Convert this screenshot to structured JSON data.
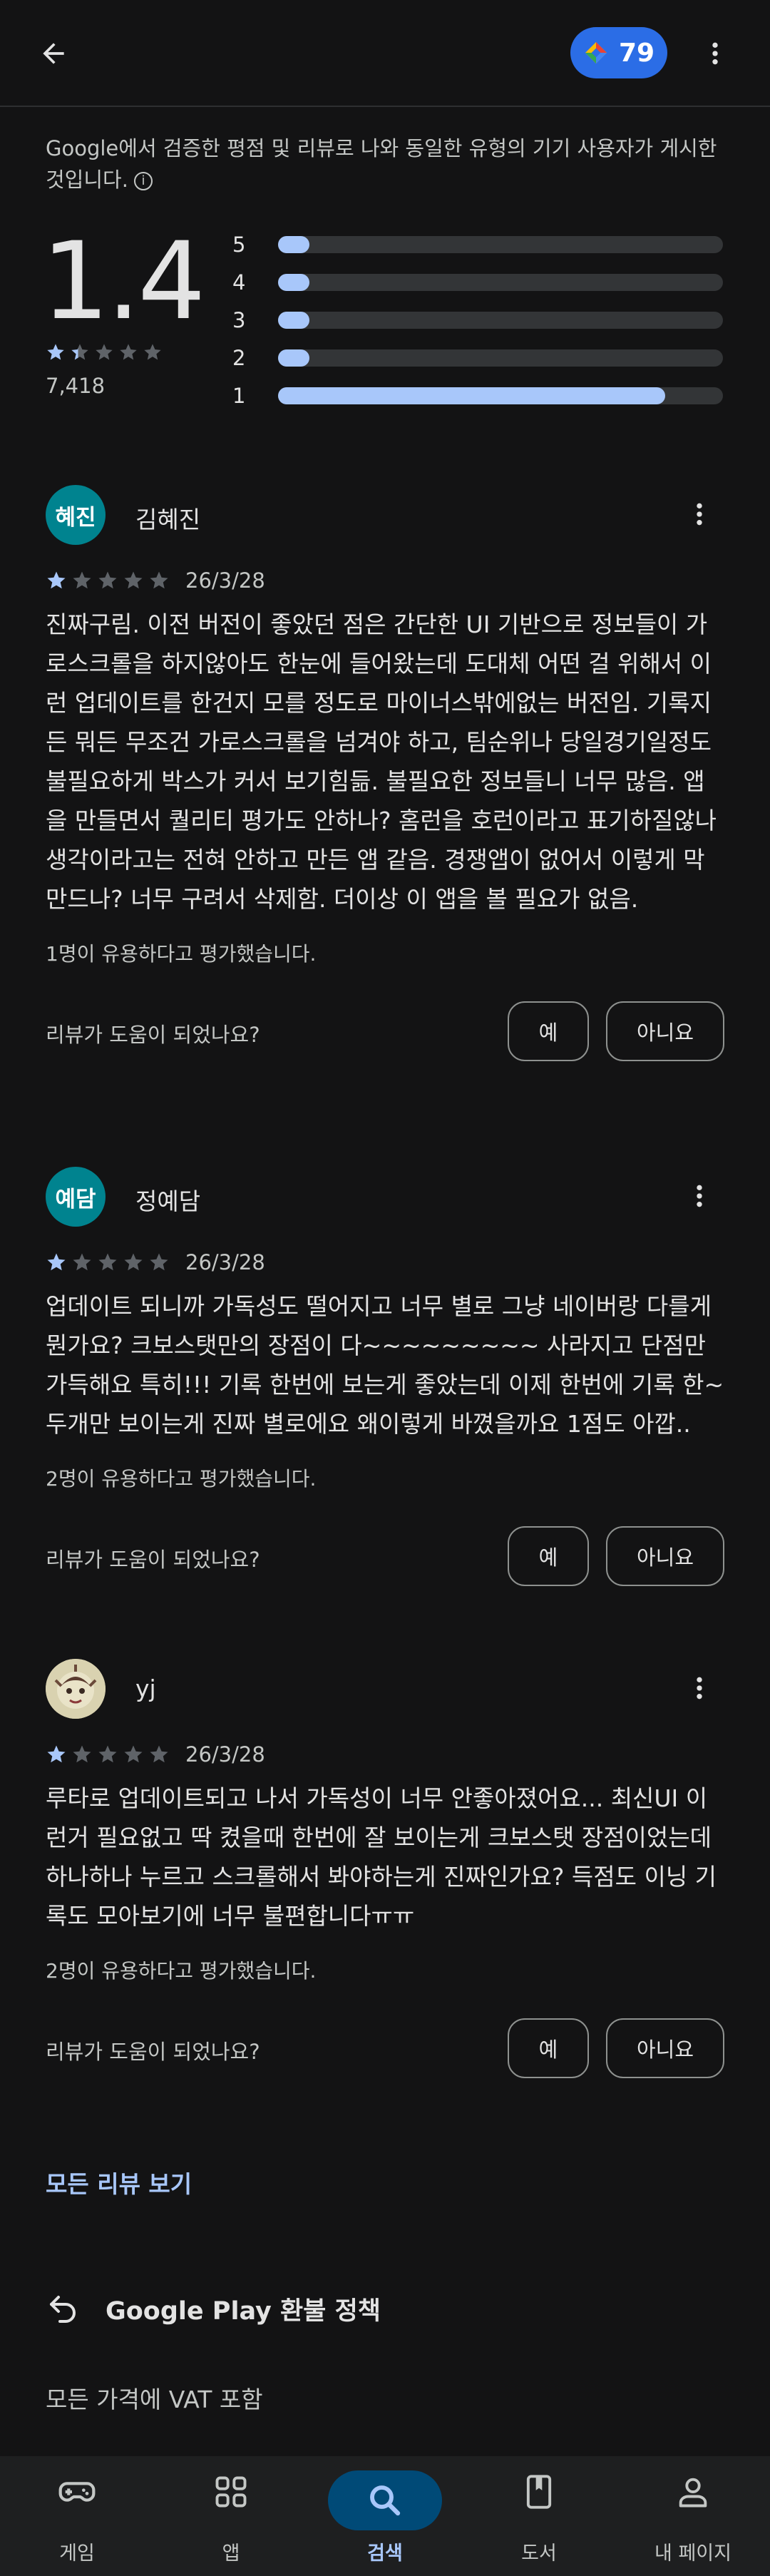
{
  "header": {
    "points": "79"
  },
  "notice": "Google에서 검증한 평점 및 리뷰로 나와 동일한 유형의 기기 사용자가 게시한 것입니다.",
  "summary": {
    "rating": "1.4",
    "stars_value": 1.4,
    "review_count": "7,418",
    "histogram": [
      {
        "label": "5",
        "fraction": 0.07
      },
      {
        "label": "4",
        "fraction": 0.04
      },
      {
        "label": "3",
        "fraction": 0.04
      },
      {
        "label": "2",
        "fraction": 0.04
      },
      {
        "label": "1",
        "fraction": 0.87
      }
    ]
  },
  "reviews": [
    {
      "avatar_text": "혜진",
      "name": "김혜진",
      "stars": 1,
      "date": "26/3/28",
      "text": "진짜구림. 이전 버전이 좋았던 점은 간단한 UI 기반으로 정보들이 가로스크롤을 하지않아도 한눈에 들어왔는데 도대체 어떤 걸 위해서 이런 업데이트를 한건지 모를 정도로 마이너스밖에없는 버전임. 기록지든 뭐든 무조건 가로스크롤을 넘겨야 하고, 팀순위나 당일경기일정도 불필요하게 박스가 커서 보기힘듦. 불필요한 정보들니 너무 많음. 앱을 만들면서 퀄리티 평가도 안하나? 홈런을 호런이라고 표기하질않나 생각이라고는 전혀 안하고 만든 앱 같음. 경쟁앱이 없어서 이렇게 막 만드나? 너무 구려서 삭제함. 더이상 이 앱을 볼 필요가 없음.",
      "helpful": "1명이 유용하다고 평가했습니다.",
      "question": "리뷰가 도움이 되었나요?",
      "yes": "예",
      "no": "아니요"
    },
    {
      "avatar_text": "예담",
      "name": "정예담",
      "stars": 1,
      "date": "26/3/28",
      "text": "업데이트 되니까 가독성도 떨어지고 너무 별로 그냥 네이버랑 다를게 뭔가요? 크보스탯만의 장점이 다~~~~~~~~~ 사라지고 단점만 가득해요 특히!!! 기록 한번에 보는게 좋았는데 이제 한번에 기록 한~두개만 보이는게 진짜 별로에요 왜이렇게 바꼈을까요 1점도 아깝..",
      "helpful": "2명이 유용하다고 평가했습니다.",
      "question": "리뷰가 도움이 되었나요?",
      "yes": "예",
      "no": "아니요"
    },
    {
      "avatar_text": "",
      "name": "yj",
      "stars": 1,
      "date": "26/3/28",
      "text": "루타로 업데이트되고 나서 가독성이 너무 안좋아졌어요... 최신UI 이런거 필요없고 딱 켰을때 한번에 잘 보이는게 크보스탯 장점이었는데 하나하나 누르고 스크롤해서 봐야하는게 진짜인가요? 득점도 이닝 기록도 모아보기에 너무 불편합니다ㅠㅠ",
      "helpful": "2명이 유용하다고 평가했습니다.",
      "question": "리뷰가 도움이 되었나요?",
      "yes": "예",
      "no": "아니요"
    }
  ],
  "links": {
    "all_reviews": "모든 리뷰 보기",
    "refund": "Google Play 환불 정책",
    "vat": "모든 가격에 VAT 포함"
  },
  "nav": [
    {
      "label": "게임",
      "icon": "gamepad-icon"
    },
    {
      "label": "앱",
      "icon": "apps-grid-icon"
    },
    {
      "label": "검색",
      "icon": "search-icon"
    },
    {
      "label": "도서",
      "icon": "book-icon"
    },
    {
      "label": "내 페이지",
      "icon": "person-icon"
    }
  ],
  "colors": {
    "accent": "#a8c7fa",
    "star": "#a8c7fa",
    "star_empty": "#5f6368",
    "avatar": "#00838f",
    "points_bg": "#2b6de6"
  }
}
